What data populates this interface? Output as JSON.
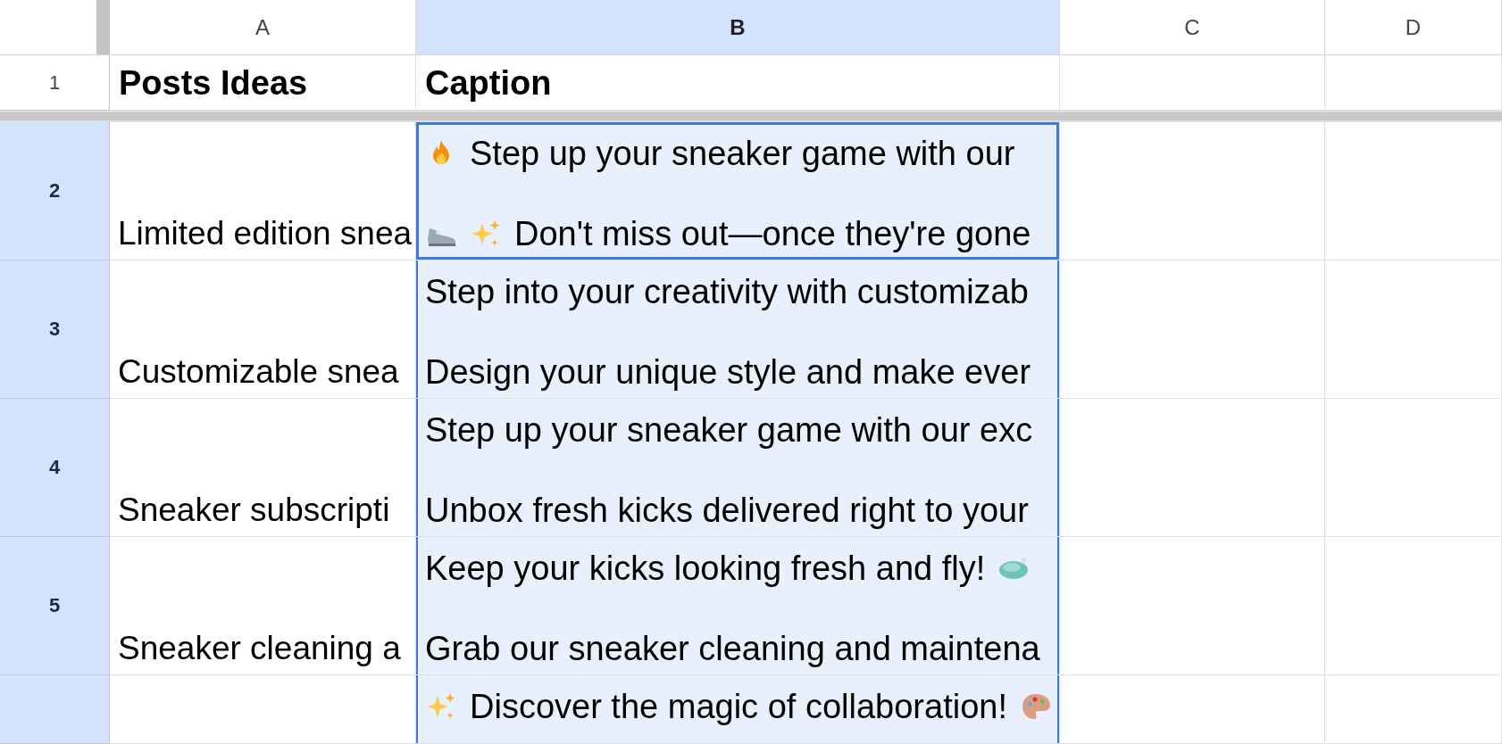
{
  "column_headers": [
    {
      "label": "A",
      "selected": false
    },
    {
      "label": "B",
      "selected": true
    },
    {
      "label": "C",
      "selected": false
    },
    {
      "label": "D",
      "selected": false
    }
  ],
  "rows": [
    {
      "number": "1",
      "selected": false,
      "kind": "header",
      "cells": [
        {
          "text": "Posts Ideas",
          "selected": false,
          "active": false
        },
        {
          "text": "Caption",
          "selected": false,
          "active": false
        },
        {
          "selected": false,
          "active": false
        },
        {
          "selected": false,
          "active": false
        }
      ]
    },
    {
      "number": "2",
      "selected": true,
      "kind": "data",
      "cells": [
        {
          "text": "Limited edition snea",
          "selected": false,
          "active": false
        },
        {
          "lines": [
            [
              {
                "kind": "fire"
              },
              {
                "kind": "text",
                "text": "Step up your sneaker game with our"
              }
            ],
            [
              {
                "kind": "sneaker"
              },
              {
                "kind": "sparkles"
              },
              {
                "kind": "text",
                "text": "Don't miss out—once they're gone"
              }
            ]
          ],
          "selected": true,
          "active": true
        },
        {
          "selected": false,
          "active": false
        },
        {
          "selected": false,
          "active": false
        }
      ]
    },
    {
      "number": "3",
      "selected": true,
      "kind": "data",
      "cells": [
        {
          "text": "Customizable snea",
          "selected": false,
          "active": false
        },
        {
          "lines": [
            [
              {
                "kind": "text",
                "text": "Step into your creativity with customizab"
              }
            ],
            [
              {
                "kind": "text",
                "text": "Design your unique style and make ever"
              }
            ]
          ],
          "selected": true,
          "active": false
        },
        {
          "selected": false,
          "active": false
        },
        {
          "selected": false,
          "active": false
        }
      ]
    },
    {
      "number": "4",
      "selected": true,
      "kind": "data",
      "cells": [
        {
          "text": "Sneaker subscripti",
          "selected": false,
          "active": false
        },
        {
          "lines": [
            [
              {
                "kind": "text",
                "text": "Step up your sneaker game with our exc"
              }
            ],
            [
              {
                "kind": "text",
                "text": "Unbox fresh kicks delivered right to your"
              }
            ]
          ],
          "selected": true,
          "active": false
        },
        {
          "selected": false,
          "active": false
        },
        {
          "selected": false,
          "active": false
        }
      ]
    },
    {
      "number": "5",
      "selected": true,
      "kind": "data",
      "cells": [
        {
          "text": "Sneaker cleaning a",
          "selected": false,
          "active": false
        },
        {
          "lines": [
            [
              {
                "kind": "text",
                "text": "Keep your kicks looking fresh and fly!"
              },
              {
                "kind": "soap"
              }
            ],
            [
              {
                "kind": "text",
                "text": "Grab our sneaker cleaning and maintena"
              }
            ]
          ],
          "selected": true,
          "active": false
        },
        {
          "selected": false,
          "active": false
        },
        {
          "selected": false,
          "active": false
        }
      ]
    },
    {
      "selected": true,
      "kind": "data",
      "cells": [
        {
          "selected": false,
          "active": false
        },
        {
          "lines": [
            [
              {
                "kind": "sparkles"
              },
              {
                "kind": "text",
                "text": "Discover the magic of collaboration!"
              },
              {
                "kind": "palette"
              }
            ]
          ],
          "selected": true,
          "active": false
        },
        {
          "selected": false,
          "active": false
        },
        {
          "selected": false,
          "active": false
        }
      ]
    }
  ]
}
